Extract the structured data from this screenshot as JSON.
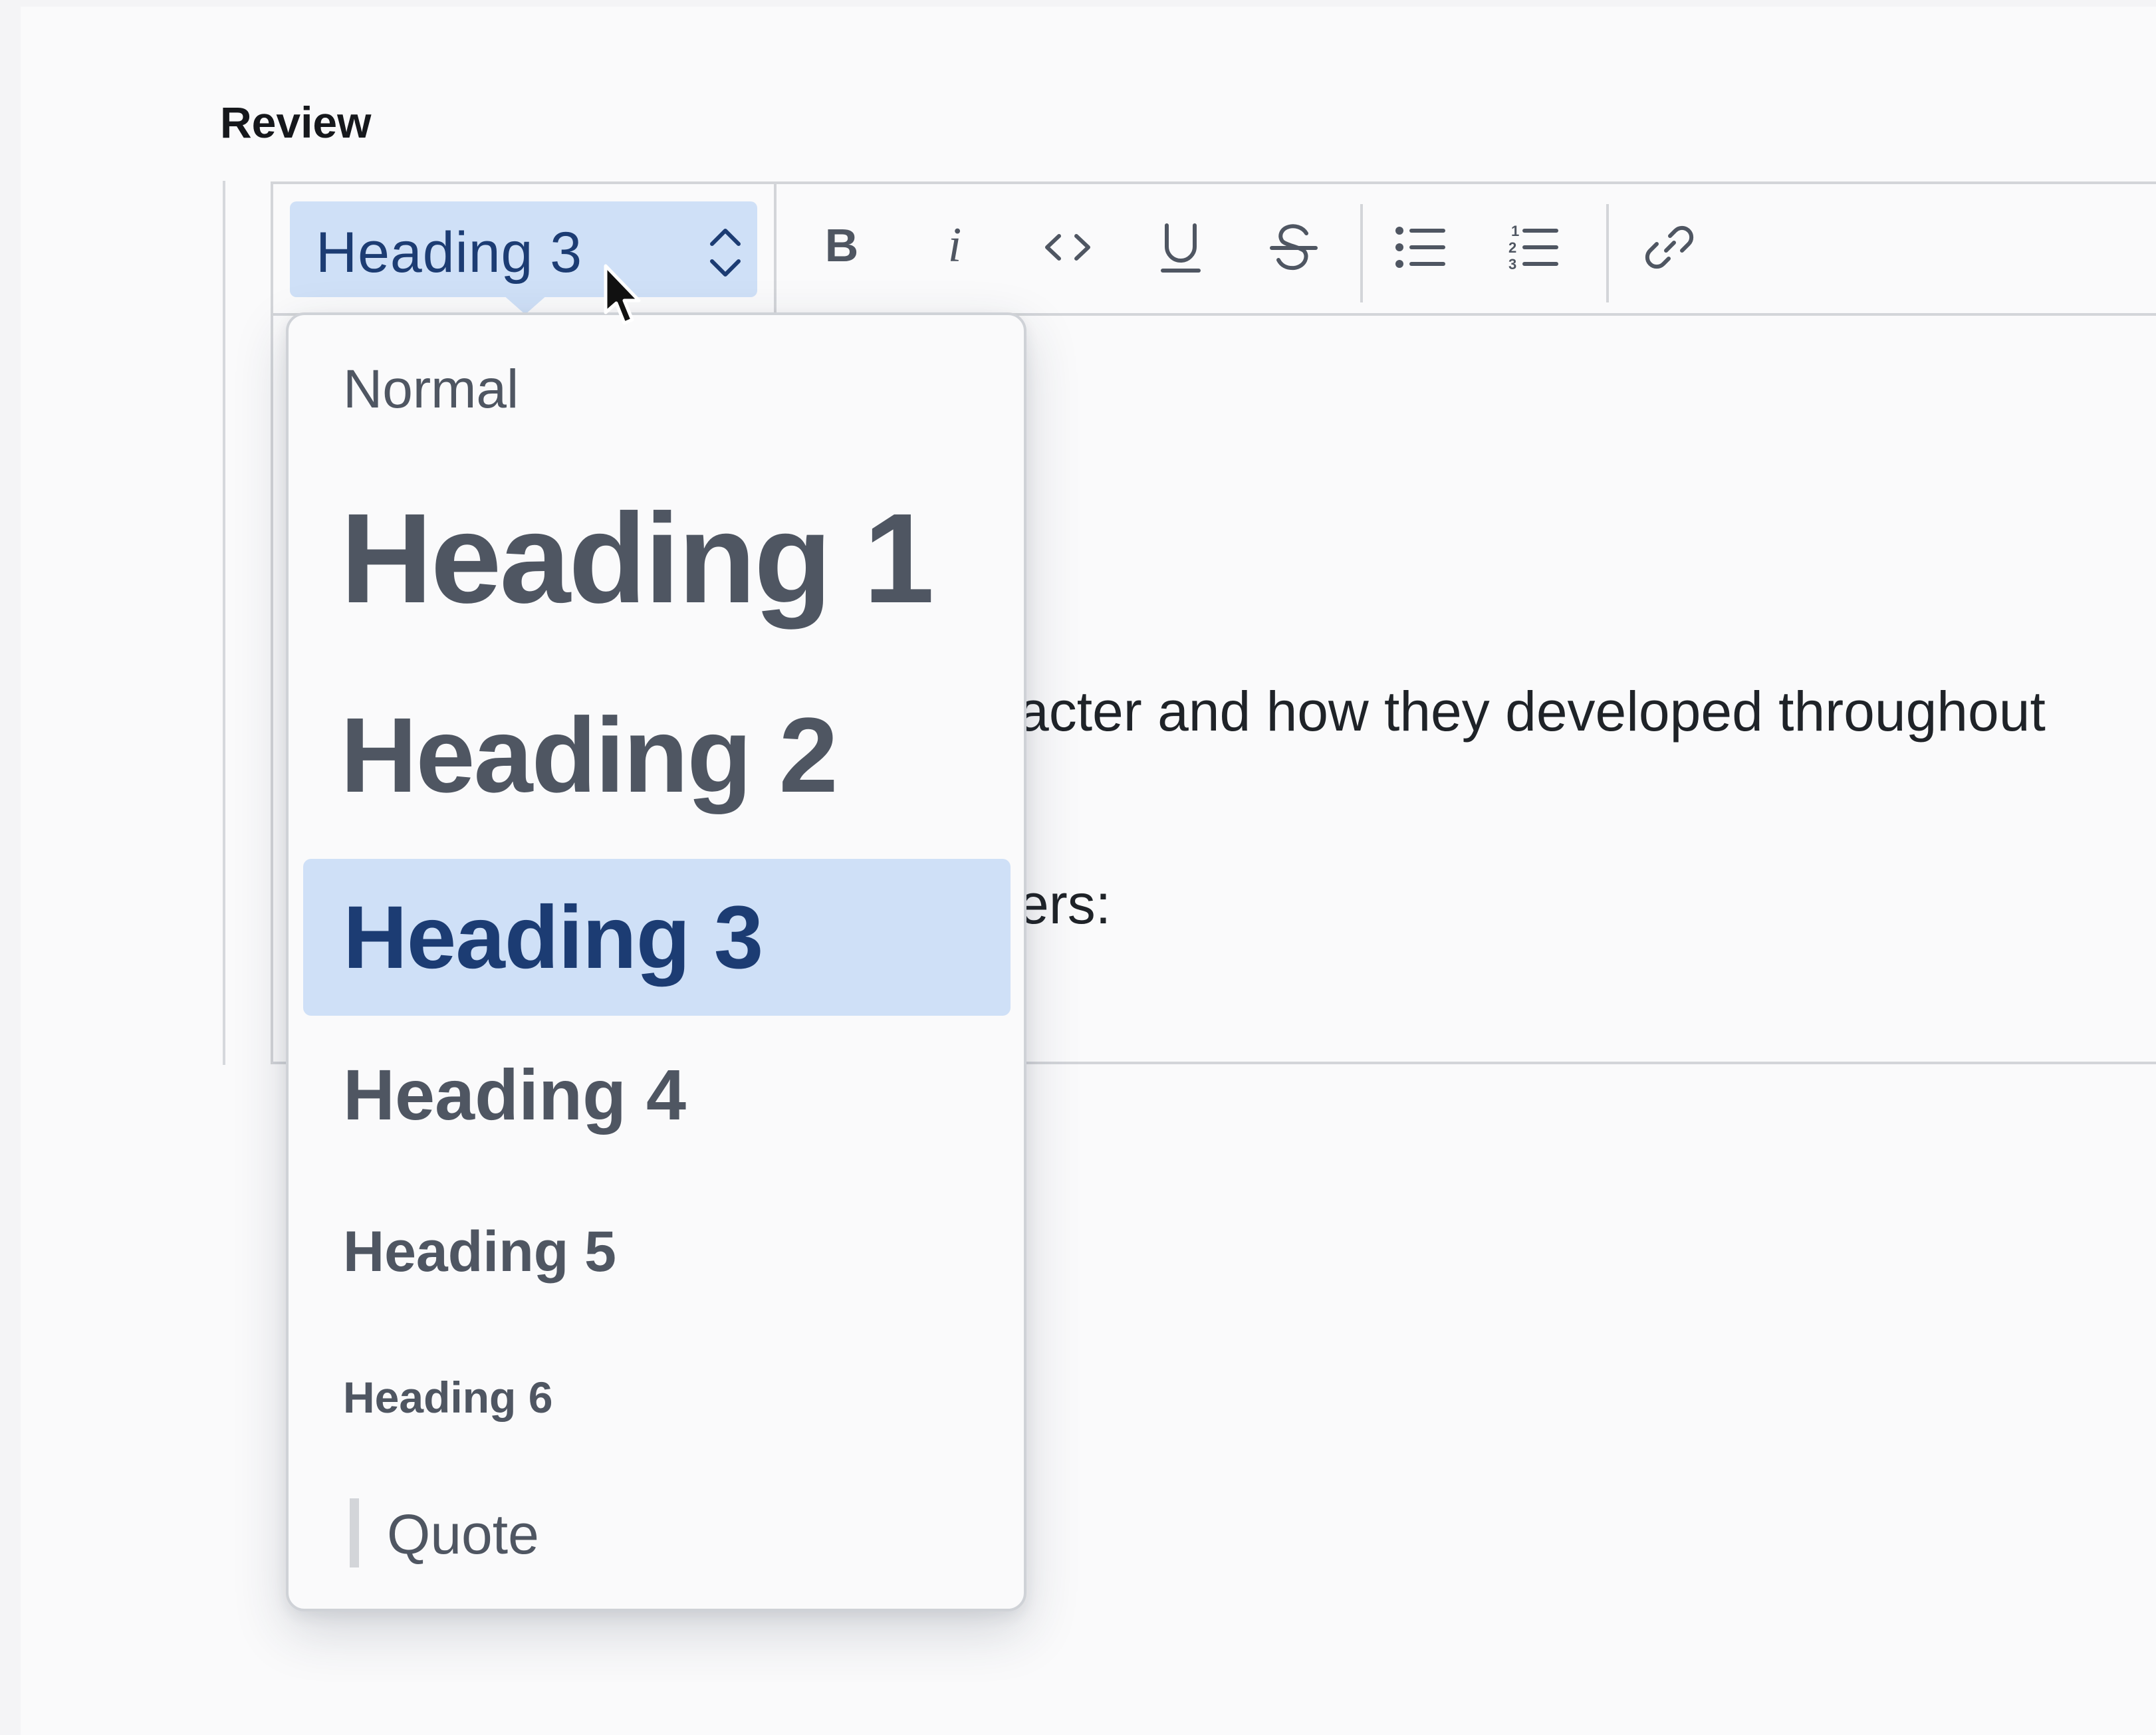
{
  "form": {
    "label": "Review"
  },
  "toolbar": {
    "block_type": {
      "value": "Heading 3",
      "icon": "chevron-up-down-icon"
    },
    "buttons": [
      {
        "name": "bold-button",
        "icon": "bold-icon"
      },
      {
        "name": "italic-button",
        "icon": "italic-icon"
      },
      {
        "name": "code-button",
        "icon": "code-icon"
      },
      {
        "name": "underline-button",
        "icon": "underline-icon"
      },
      {
        "name": "strikethrough-button",
        "icon": "strikethrough-icon"
      },
      {
        "name": "bulleted-list-button",
        "icon": "bulleted-list-icon"
      },
      {
        "name": "numbered-list-button",
        "icon": "numbered-list-icon"
      },
      {
        "name": "link-button",
        "icon": "link-icon"
      }
    ]
  },
  "editor": {
    "lines": [
      "acter and how they developed throughout",
      "ers:"
    ]
  },
  "dropdown": {
    "options": [
      {
        "label": "Normal",
        "selected": false
      },
      {
        "label": "Heading 1",
        "selected": false
      },
      {
        "label": "Heading 2",
        "selected": false
      },
      {
        "label": "Heading 3",
        "selected": true
      },
      {
        "label": "Heading 4",
        "selected": false
      },
      {
        "label": "Heading 5",
        "selected": false
      },
      {
        "label": "Heading 6",
        "selected": false
      },
      {
        "label": "Quote",
        "selected": false
      }
    ]
  },
  "colors": {
    "accent_bg": "#cfe0f7",
    "accent_text": "#1c3c73",
    "option_text": "#4f5662",
    "border": "#d3d5d9"
  }
}
